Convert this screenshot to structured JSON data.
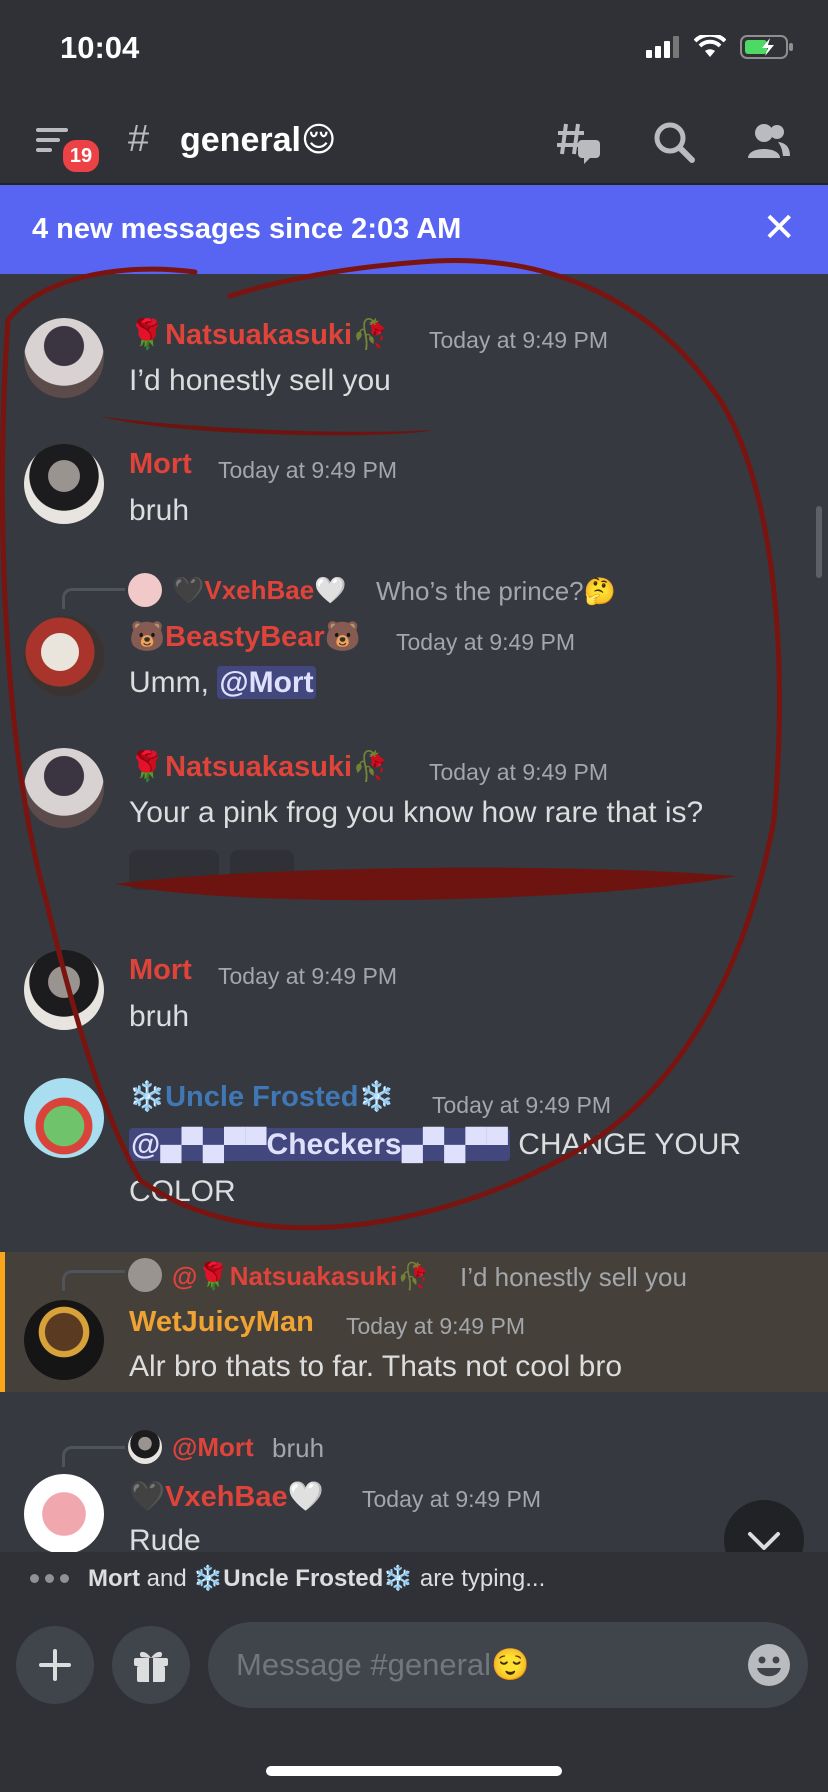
{
  "status_bar": {
    "time": "10:04"
  },
  "header": {
    "unread_badge": "19",
    "channel_hash": "#",
    "channel_name": "general😌",
    "icons": [
      "menu-icon",
      "threads-icon",
      "search-icon",
      "members-icon"
    ]
  },
  "banner": {
    "text": "4 new messages since 2:03 AM",
    "close": "✕"
  },
  "messages": [
    {
      "author": "Natsuakasuki",
      "author_prefix": "🌹",
      "author_suffix": "🥀",
      "author_color": "#e0433a",
      "timestamp": "Today at 9:49 PM",
      "text": "I’d honestly sell you"
    },
    {
      "author": "Mort",
      "author_color": "#e0433a",
      "timestamp": "Today at 9:49 PM",
      "text": "bruh"
    },
    {
      "reply_author": "🖤VxehBae🤍",
      "reply_text": "Who’s the prince?🤔",
      "author": "BeastyBear",
      "author_prefix": "🐻",
      "author_suffix": "🐻",
      "author_color": "#e0433a",
      "timestamp": "Today at 9:49 PM",
      "text_before": "Umm, ",
      "mention": "@Mort"
    },
    {
      "author": "Natsuakasuki",
      "author_prefix": "🌹",
      "author_suffix": "🥀",
      "author_color": "#e0433a",
      "timestamp": "Today at 9:49 PM",
      "text": "Your a pink frog you know how rare that is?"
    },
    {
      "author": "Mort",
      "author_color": "#e0433a",
      "timestamp": "Today at 9:49 PM",
      "text": "bruh"
    },
    {
      "author": "Uncle Frosted",
      "author_prefix": "❄️",
      "author_suffix": "❄️",
      "author_color": "#3f78b5",
      "timestamp": "Today at 9:49 PM",
      "mention": "@▄▀▄▀▀Checkers▄▀▄▀▀",
      "text_after": " CHANGE YOUR",
      "text_line2": "COLOR"
    },
    {
      "reply_author": "@🌹Natsuakasuki🥀",
      "reply_text": "I’d honestly sell you",
      "author": "WetJuicyMan",
      "author_color": "#f0a332",
      "timestamp": "Today at 9:49 PM",
      "text": "Alr bro thats to far. Thats not cool bro",
      "highlighted": true
    },
    {
      "reply_author": "@Mort",
      "reply_text": "bruh",
      "author": "VxehBae",
      "author_prefix": "🖤",
      "author_suffix": "🤍",
      "author_color": "#e0433a",
      "timestamp": "Today at 9:49 PM",
      "text": "Rude"
    }
  ],
  "typing": {
    "user1": "Mort",
    "and": "and",
    "user2": "❄️Uncle Frosted❄️",
    "suffix": "are typing..."
  },
  "composer": {
    "placeholder": "Message #general😌",
    "icons": [
      "plus-icon",
      "gift-icon",
      "emoji-icon"
    ]
  },
  "colors": {
    "background": "#36393f",
    "header": "#2f3136",
    "accent": "#5865f2",
    "annotation": "#7a1410"
  }
}
